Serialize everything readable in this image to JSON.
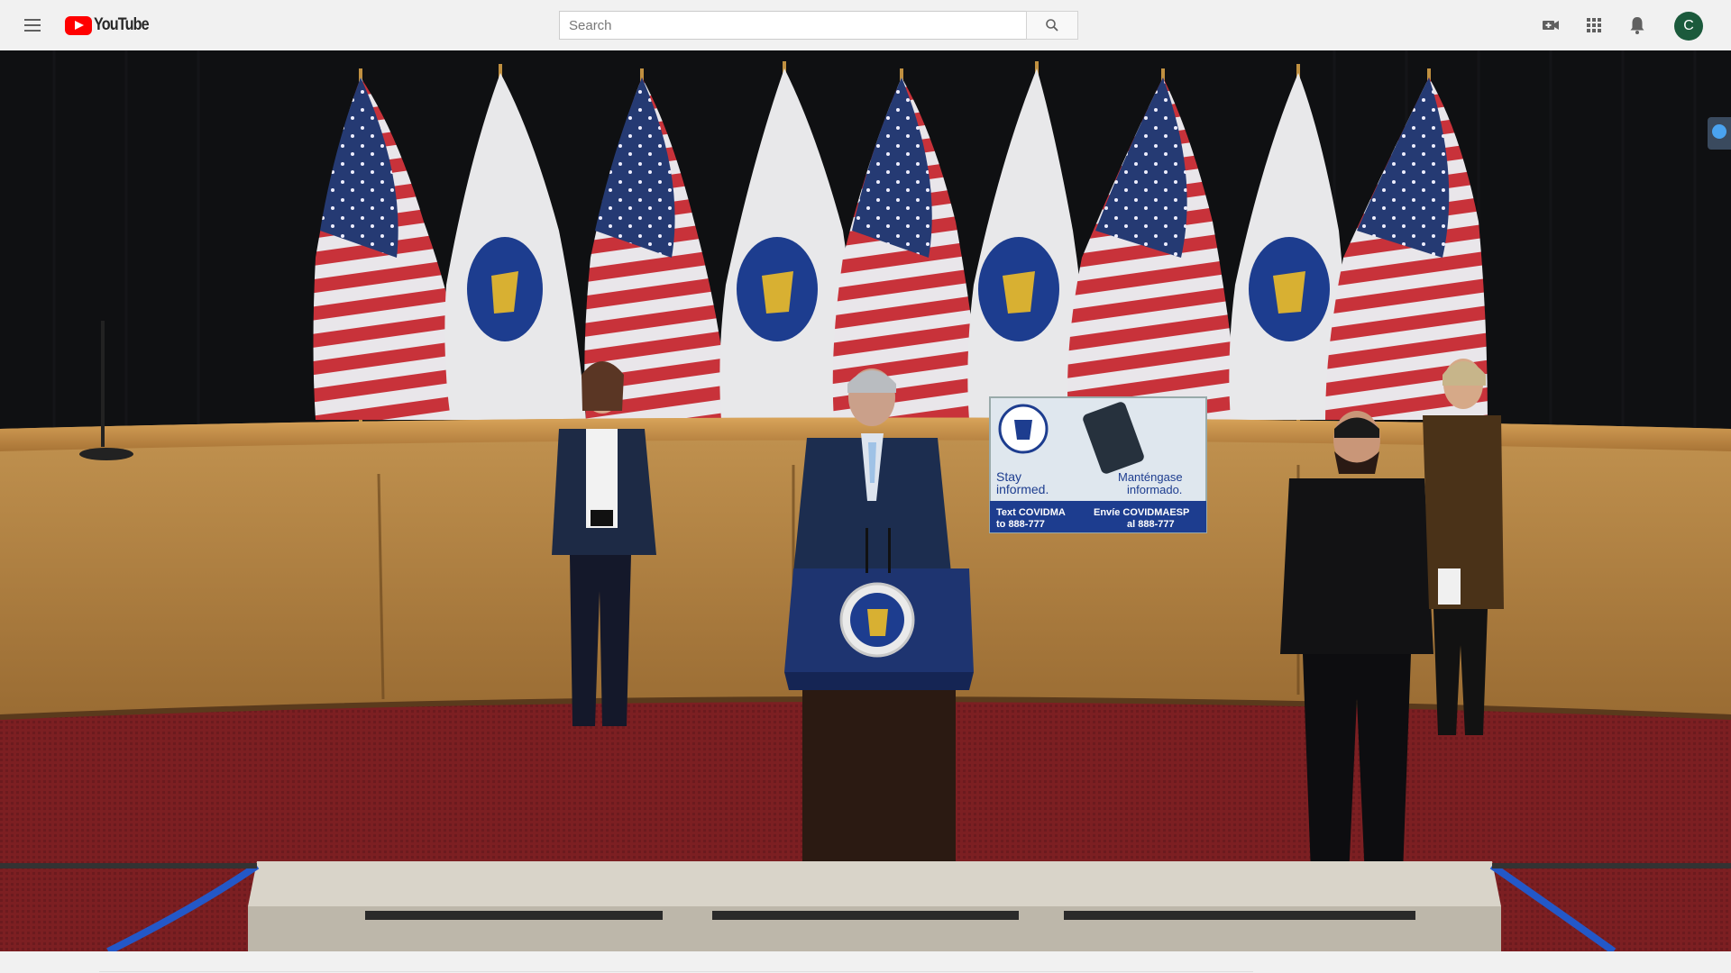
{
  "header": {
    "menu_icon": "hamburger-menu-icon",
    "logo_text": "YouTube",
    "search": {
      "placeholder": "Search",
      "value": ""
    },
    "search_icon": "magnifier-icon",
    "icons": [
      "create-video-icon",
      "apps-grid-icon",
      "notifications-bell-icon"
    ],
    "avatar_letter": "C",
    "avatar_color": "#1b5a3c"
  },
  "video": {
    "poster_card": {
      "left_text": "Stay informed.",
      "right_text": "Manténgase informado.",
      "left_cta": "Text COVIDMA to 888-777",
      "right_cta": "Envíe COVIDMAESP al 888-777"
    }
  },
  "colors": {
    "accent": "#ff0000",
    "topbar_bg": "#f1f1f1",
    "carpet": "#7a1f22",
    "wood": "#b98845"
  }
}
